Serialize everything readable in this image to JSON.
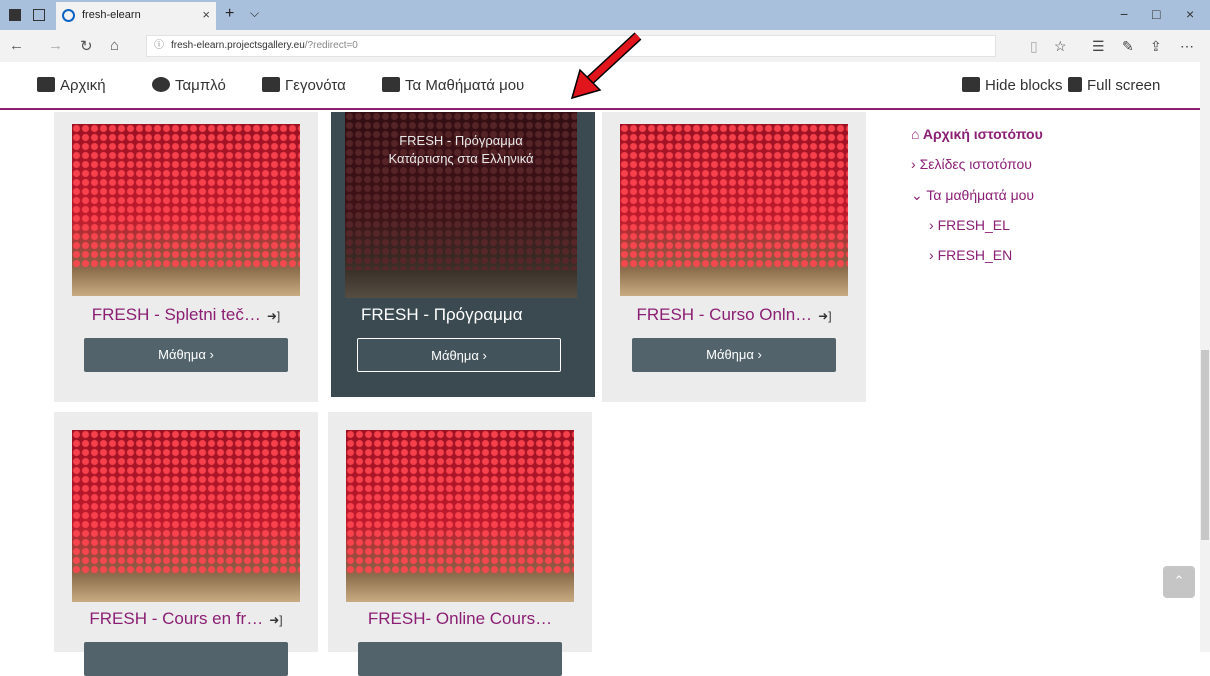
{
  "browser": {
    "tab_title": "fresh-elearn",
    "tab_close": "×",
    "new_tab": "+",
    "tab_menu": "⌵",
    "url_host": "fresh-elearn.projectsgallery.eu",
    "url_path": "/?redirect=0",
    "window": {
      "minimize": "−",
      "maximize": "□",
      "close": "×"
    }
  },
  "nav": {
    "home": "Αρχική",
    "dashboard": "Ταμπλό",
    "events": "Γεγονότα",
    "my_courses": "Τα Μαθήματά μου",
    "hide_blocks": "Hide blocks",
    "full_screen": "Full screen"
  },
  "courses": [
    {
      "title": "FRESH - Spletni teč…",
      "button": "Μάθημα ›",
      "enrol_icon": "sign-in-icon"
    },
    {
      "title": "FRESH - Πρόγραμμα",
      "overlay": "FRESH - Πρόγραμμα Κατάρτισης στα Ελληνικά",
      "button": "Μάθημα ›"
    },
    {
      "title": "FRESH - Curso Onln…",
      "button": "Μάθημα ›",
      "enrol_icon": "sign-in-icon"
    },
    {
      "title": "FRESH - Cours en fr…",
      "enrol_icon": "sign-in-icon"
    },
    {
      "title": "FRESH- Online Cours…"
    }
  ],
  "navigation_block": {
    "home": "Αρχική ιστοτόπου",
    "site_pages": "Σελίδες ιστοτόπου",
    "my_courses": "Τα μαθήματά μου",
    "course_el": "FRESH_EL",
    "course_en": "FRESH_EN"
  },
  "colors": {
    "accent": "#8b1f74",
    "button": "#52636b",
    "chrome": "#a9c0dc"
  }
}
